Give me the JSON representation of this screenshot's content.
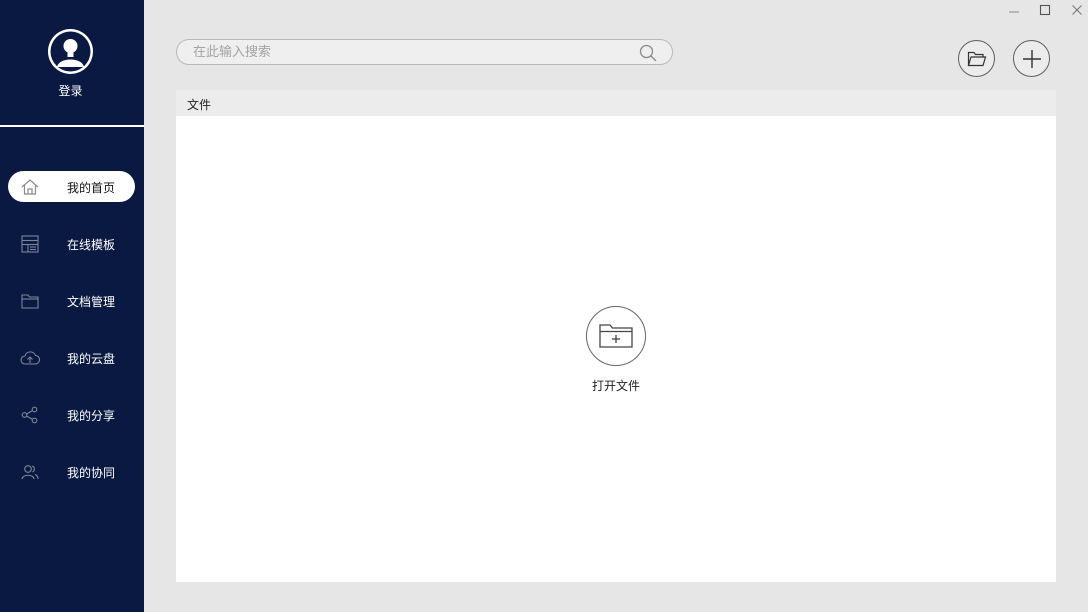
{
  "sidebar": {
    "login_label": "登录",
    "items": [
      {
        "label": "我的首页",
        "icon": "home-icon",
        "active": true
      },
      {
        "label": "在线模板",
        "icon": "template-icon",
        "active": false
      },
      {
        "label": "文档管理",
        "icon": "folder-icon",
        "active": false
      },
      {
        "label": "我的云盘",
        "icon": "cloud-upload-icon",
        "active": false
      },
      {
        "label": "我的分享",
        "icon": "share-icon",
        "active": false
      },
      {
        "label": "我的协同",
        "icon": "users-icon",
        "active": false
      }
    ]
  },
  "search": {
    "placeholder": "在此输入搜索",
    "value": ""
  },
  "toolbar": {
    "open_folder_icon": "folder-open-icon",
    "add_icon": "plus-icon"
  },
  "window_controls": [
    "minimize-icon",
    "maximize-icon",
    "close-icon"
  ],
  "main": {
    "header_label": "文件",
    "open_file_label": "打开文件"
  },
  "colors": {
    "sidebar_bg": "#091942",
    "page_bg": "#e6e6e6",
    "panel_bg": "#ffffff"
  }
}
